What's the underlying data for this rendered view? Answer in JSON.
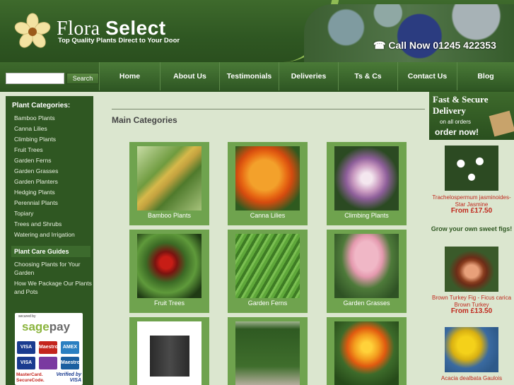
{
  "header": {
    "brand_light": "Flora",
    "brand_bold": "Select",
    "tagline": "Top Quality Plants Direct to Your Door",
    "phone": "Call Now 01245 422353"
  },
  "search": {
    "placeholder": "",
    "button": "Search"
  },
  "nav": [
    {
      "label": "Home"
    },
    {
      "label": "About Us"
    },
    {
      "label": "Testimonials"
    },
    {
      "label": "Deliveries"
    },
    {
      "label": "Ts & Cs"
    },
    {
      "label": "Contact Us"
    },
    {
      "label": "Blog"
    }
  ],
  "sidebar": {
    "categories_heading": "Plant Categories:",
    "categories": [
      "Bamboo Plants",
      "Canna Lilies",
      "Climbing Plants",
      "Fruit Trees",
      "Garden Ferns",
      "Garden Grasses",
      "Garden Planters",
      "Hedging Plants",
      "Perennial Plants",
      "Topiary",
      "Trees and Shrubs",
      "Watering and Irrigation"
    ],
    "guides_heading": "Plant Care Guides",
    "guides": [
      "Choosing Plants for Your Garden",
      "How We Package Our Plants and Pots"
    ],
    "payment": {
      "secured_by": "secured by",
      "brand_sage": "sage",
      "brand_pay": "pay",
      "cards": [
        "VISA",
        "Maestro",
        "AMEX",
        "VISA",
        "",
        "Maestro"
      ],
      "mastercard": "MasterCard. SecureCode.",
      "verified": "Verified by VISA"
    }
  },
  "main": {
    "title": "Main Categories",
    "tiles": [
      {
        "label": "Bamboo Plants"
      },
      {
        "label": "Canna Lilies"
      },
      {
        "label": "Climbing Plants"
      },
      {
        "label": "Fruit Trees"
      },
      {
        "label": "Garden Ferns"
      },
      {
        "label": "Garden Grasses"
      },
      {
        "label": ""
      },
      {
        "label": ""
      },
      {
        "label": ""
      }
    ]
  },
  "right": {
    "promo_line1": "Fast & Secure",
    "promo_line2": "Delivery",
    "promo_line3": "on all orders",
    "promo_line4": "order now!",
    "products": [
      {
        "name": "Trachelospermum jasminoides-Star Jasmine",
        "price": "From £17.50"
      },
      {
        "name": "Brown Turkey Fig - Ficus carica Brown Turkey",
        "price": "From £13.50"
      },
      {
        "name": "Acacia dealbata Gaulois",
        "price": ""
      }
    ],
    "figs_heading": "Grow your own sweet figs!"
  },
  "colors": {
    "brand_green": "#2f5722",
    "tile_green": "#6fa34e",
    "price_red": "#c0281d"
  }
}
